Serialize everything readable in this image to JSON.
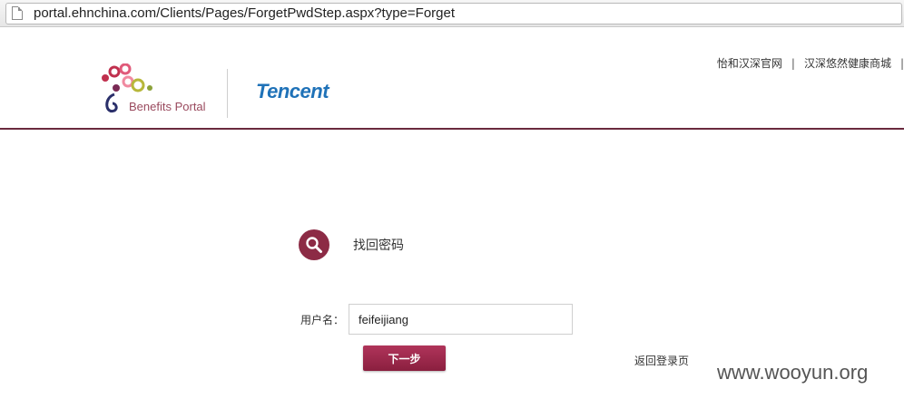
{
  "browser": {
    "url": "portal.ehnchina.com/Clients/Pages/ForgetPwdStep.aspx?type=Forget",
    "page_icon": "document-icon"
  },
  "header": {
    "logo_text": "Benefits Portal",
    "partner_logo_text": "Tencent",
    "links": [
      "怡和汉深官网",
      "汉深悠然健康商城"
    ],
    "separator": "|",
    "accent_color": "#6a2a3e"
  },
  "main": {
    "section_icon": "search-icon",
    "section_title": "找回密码",
    "username_label": "用户名：",
    "username_value": "feifeijiang",
    "next_button": "下一步",
    "back_to_login": "返回登录页",
    "button_color": "#9c2a4c"
  },
  "watermark": "www.wooyun.org"
}
